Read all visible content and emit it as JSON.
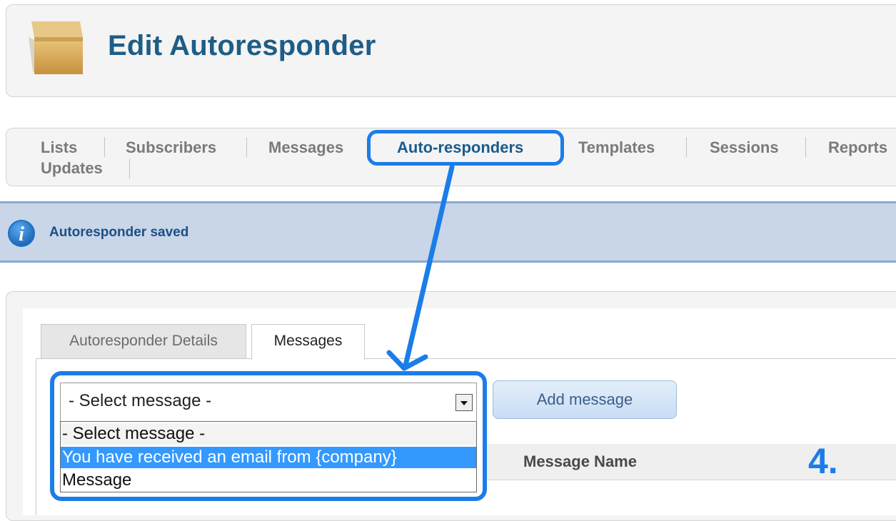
{
  "header": {
    "title": "Edit Autoresponder",
    "icon": "box-icon"
  },
  "nav": {
    "items": [
      "Lists",
      "Subscribers",
      "Messages",
      "Auto-responders",
      "Templates",
      "Sessions",
      "Reports",
      "Updates"
    ],
    "active": "Auto-responders"
  },
  "info": {
    "icon": "info-icon",
    "message": "Autoresponder saved"
  },
  "tabs": {
    "details": "Autoresponder Details",
    "messages": "Messages",
    "active": "Messages"
  },
  "message_select": {
    "value": "- Select message -",
    "options": [
      "- Select message -",
      "You have received an email from {company}",
      "Message"
    ],
    "highlighted_option": "You have received an email from {company}"
  },
  "add_button": {
    "label": "Add message"
  },
  "table": {
    "columns": [
      "Message Name"
    ]
  },
  "annotation": {
    "step": "4.",
    "color": "#1b7de8"
  },
  "colors": {
    "title": "#1e5d86",
    "banner_bg": "#c8d6e8",
    "banner_text": "#1d4f85",
    "selected_option": "#3399ff"
  }
}
